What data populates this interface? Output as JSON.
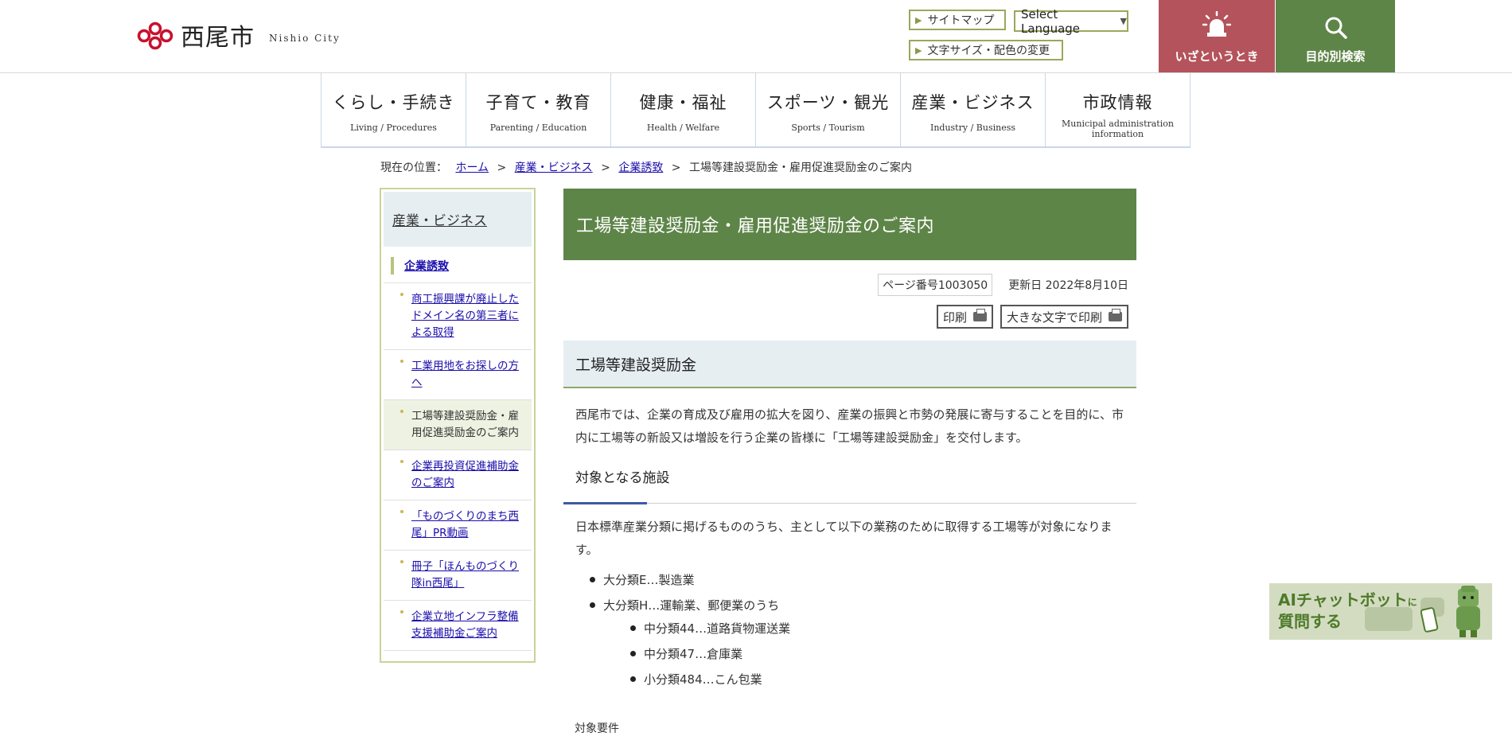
{
  "header": {
    "city_name": "西尾市",
    "city_en": "Nishio City",
    "sitemap": "サイトマップ",
    "text_size": "文字サイズ・配色の変更",
    "language": "Select Language",
    "emergency": "いざというとき",
    "search": "目的別検索"
  },
  "nav": [
    {
      "ja": "くらし・手続き",
      "en": "Living / Procedures"
    },
    {
      "ja": "子育て・教育",
      "en": "Parenting / Education"
    },
    {
      "ja": "健康・福祉",
      "en": "Health / Welfare"
    },
    {
      "ja": "スポーツ・観光",
      "en": "Sports / Tourism"
    },
    {
      "ja": "産業・ビジネス",
      "en": "Industry / Business"
    },
    {
      "ja": "市政情報",
      "en": "Municipal administration information"
    }
  ],
  "breadcrumb": {
    "label": "現在の位置：",
    "items": [
      "ホーム",
      "産業・ビジネス",
      "企業誘致"
    ],
    "current": "工場等建設奨励金・雇用促進奨励金のご案内"
  },
  "sidebar": {
    "heading": "産業・ビジネス",
    "current_section": "企業誘致",
    "items": [
      "商工振興課が廃止したドメイン名の第三者による取得",
      "工業用地をお探しの方へ",
      "工場等建設奨励金・雇用促進奨励金のご案内",
      "企業再投資促進補助金のご案内",
      "「ものづくりのまち西尾」PR動画",
      "冊子「ほんものづくり隊in西尾」",
      "企業立地インフラ整備支援補助金ご案内"
    ]
  },
  "main": {
    "title": "工場等建設奨励金・雇用促進奨励金のご案内",
    "page_no": "ページ番号1003050",
    "updated": "更新日 2022年8月10日",
    "print": "印刷",
    "print_large": "大きな文字で印刷",
    "section_title": "工場等建設奨励金",
    "intro": "西尾市では、企業の育成及び雇用の拡大を図り、産業の振興と市勢の発展に寄与することを目的に、市内に工場等の新設又は増設を行う企業の皆様に「工場等建設奨励金」を交付します。",
    "sub_title": "対象となる施設",
    "sub_text": "日本標準産業分類に掲げるもののうち、主として以下の業務のために取得する工場等が対象になります。",
    "list": [
      "大分類E…製造業",
      "大分類H…運輸業、郵便業のうち"
    ],
    "sublist": [
      "中分類44…道路貨物運送業",
      "中分類47…倉庫業",
      "小分類484…こん包業"
    ],
    "cutoff": "対象要件"
  },
  "ai_banner": {
    "line1": "AIチャットボット",
    "line1_suffix": "に",
    "line2": "質問する"
  },
  "colors": {
    "green": "#5e8548",
    "emergency_red": "#b4535b",
    "light_blue_bg": "#e7eef2"
  }
}
